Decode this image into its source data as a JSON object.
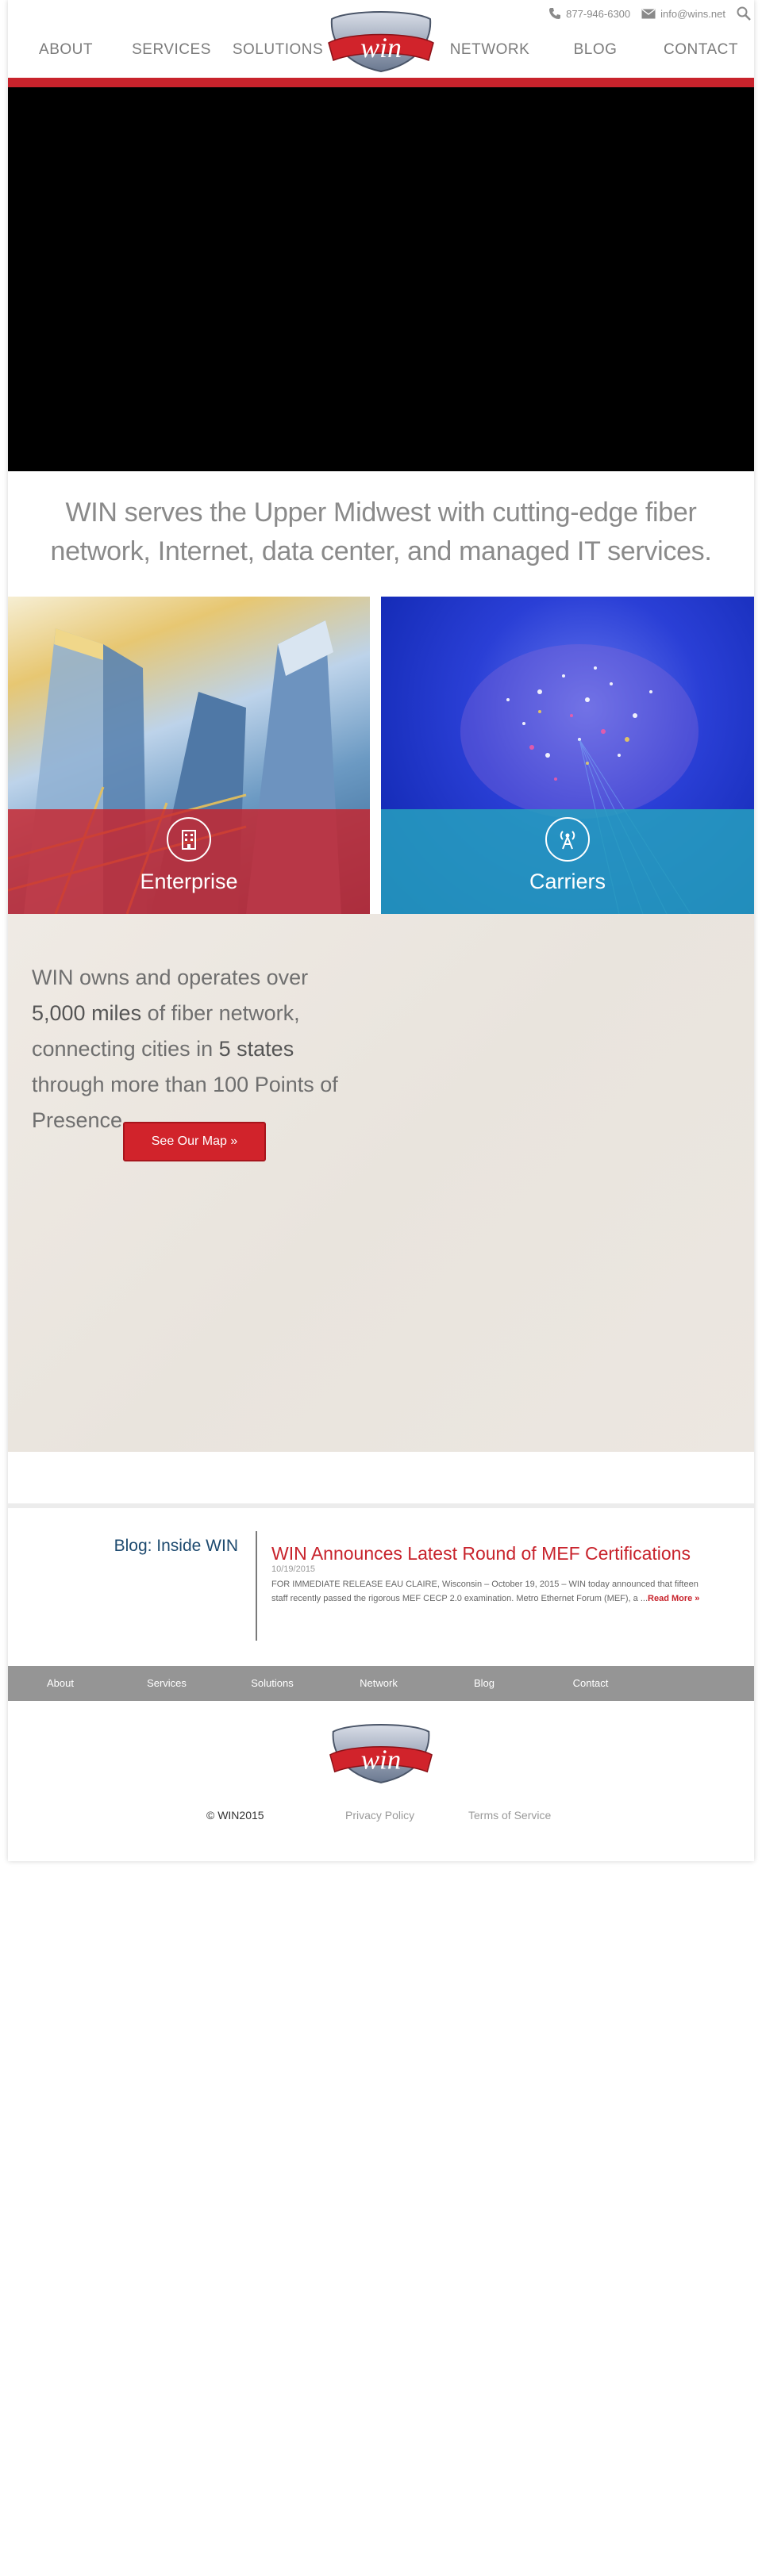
{
  "contact": {
    "phone": "877-946-6300",
    "email": "info@wins.net"
  },
  "nav": {
    "about": "ABOUT",
    "services": "SERVICES",
    "solutions": "SOLUTIONS",
    "logo": "win",
    "network": "NETWORK",
    "blog": "BLOG",
    "contact": "CONTACT"
  },
  "intro": "WIN serves the Upper Midwest with cutting-edge fiber network, Internet, data center, and managed IT services.",
  "tiles": {
    "enterprise": "Enterprise",
    "carriers": "Carriers"
  },
  "map": {
    "part1": "WIN owns and operates over ",
    "miles": "5,000 miles",
    "part2": " of fiber network, connecting cities in ",
    "states": "5 states",
    "part3": " through more than 100 Points of Presence.",
    "button": "See Our Map »"
  },
  "blog": {
    "heading": "Blog: Inside WIN",
    "title": "WIN Announces Latest Round of MEF Certifications",
    "date": "10/19/2015",
    "excerpt": "FOR IMMEDIATE RELEASE EAU CLAIRE, Wisconsin – October 19, 2015 – WIN today announced that fifteen staff recently passed the rigorous MEF CECP 2.0 examination. Metro Ethernet Forum (MEF), a ...",
    "read_more": "Read More »"
  },
  "footer_nav": {
    "about": "About",
    "services": "Services",
    "solutions": "Solutions",
    "network": "Network",
    "blog": "Blog",
    "contact": "Contact"
  },
  "footer": {
    "logo": "win",
    "copyright": "© WIN2015",
    "privacy": "Privacy Policy",
    "terms": "Terms of Service"
  },
  "colors": {
    "brand_red": "#c8232c",
    "enterprise_band": "#c8232c",
    "carriers_band": "#26a0be",
    "blog_heading": "#1d4a6f",
    "footer_nav_bg": "#959595"
  }
}
